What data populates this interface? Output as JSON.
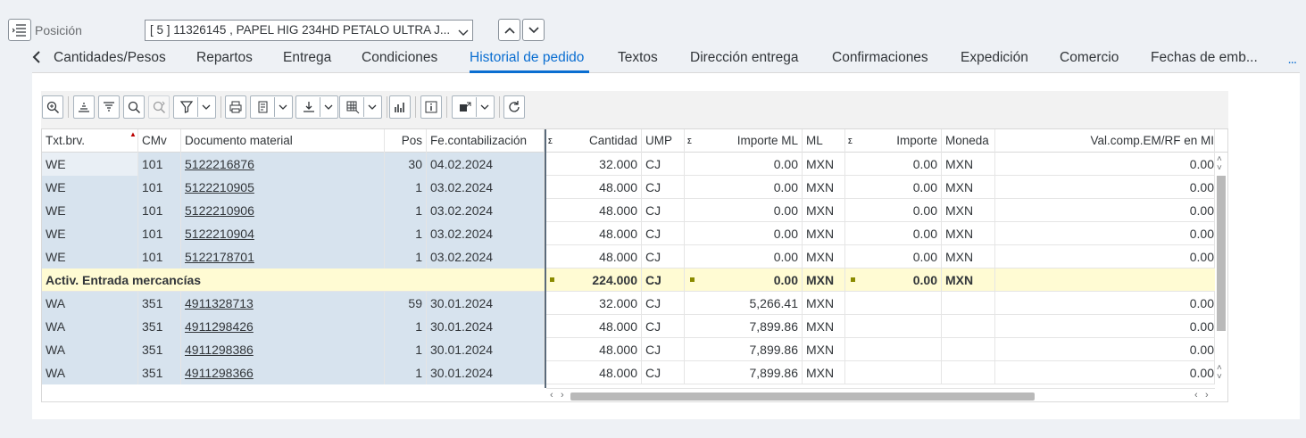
{
  "position": {
    "label": "Posición",
    "value": "[ 5 ] 11326145 , PAPEL HIG 234HD PETALO ULTRA J..."
  },
  "tabs": [
    {
      "label": "Cantidades/Pesos"
    },
    {
      "label": "Repartos"
    },
    {
      "label": "Entrega"
    },
    {
      "label": "Condiciones"
    },
    {
      "label": "Historial de pedido",
      "active": true
    },
    {
      "label": "Textos"
    },
    {
      "label": "Dirección entrega"
    },
    {
      "label": "Confirmaciones"
    },
    {
      "label": "Expedición"
    },
    {
      "label": "Comercio"
    },
    {
      "label": "Fechas de emb..."
    }
  ],
  "tabs_more": "...",
  "toolbar_icons": [
    "details-icon",
    "sort-ascending-icon",
    "sort-descending-icon",
    "find-icon",
    "find-next-icon",
    "filter-icon",
    "print-icon",
    "view-icon",
    "export-icon",
    "layout-icon",
    "chart-icon",
    "info-icon",
    "action-icon",
    "refresh-icon"
  ],
  "grid": {
    "headers": {
      "txt": "Txt.brv.",
      "cmv": "CMv",
      "doc": "Documento material",
      "pos": "Pos",
      "fecha": "Fe.contabilización",
      "cantidad": "Cantidad",
      "ump": "UMP",
      "importe_ml": "Importe ML",
      "ml": "ML",
      "importe": "Importe",
      "moneda": "Moneda",
      "valcomp": "Val.comp.EM/RF en MI"
    },
    "rows": [
      {
        "txt": "WE",
        "cmv": "101",
        "doc": "5122216876",
        "pos": "30",
        "fecha": "04.02.2024",
        "cantidad": "32.000",
        "ump": "CJ",
        "importe_ml": "0.00",
        "ml": "MXN",
        "importe": "0.00",
        "moneda": "MXN",
        "valcomp": "0.00"
      },
      {
        "txt": "WE",
        "cmv": "101",
        "doc": "5122210905",
        "pos": "1",
        "fecha": "03.02.2024",
        "cantidad": "48.000",
        "ump": "CJ",
        "importe_ml": "0.00",
        "ml": "MXN",
        "importe": "0.00",
        "moneda": "MXN",
        "valcomp": "0.00"
      },
      {
        "txt": "WE",
        "cmv": "101",
        "doc": "5122210906",
        "pos": "1",
        "fecha": "03.02.2024",
        "cantidad": "48.000",
        "ump": "CJ",
        "importe_ml": "0.00",
        "ml": "MXN",
        "importe": "0.00",
        "moneda": "MXN",
        "valcomp": "0.00"
      },
      {
        "txt": "WE",
        "cmv": "101",
        "doc": "5122210904",
        "pos": "1",
        "fecha": "03.02.2024",
        "cantidad": "48.000",
        "ump": "CJ",
        "importe_ml": "0.00",
        "ml": "MXN",
        "importe": "0.00",
        "moneda": "MXN",
        "valcomp": "0.00"
      },
      {
        "txt": "WE",
        "cmv": "101",
        "doc": "5122178701",
        "pos": "1",
        "fecha": "03.02.2024",
        "cantidad": "48.000",
        "ump": "CJ",
        "importe_ml": "0.00",
        "ml": "MXN",
        "importe": "0.00",
        "moneda": "MXN",
        "valcomp": "0.00"
      },
      {
        "subtotal": true,
        "label": "Activ. Entrada mercancías",
        "cantidad": "224.000",
        "ump": "CJ",
        "importe_ml": "0.00",
        "ml": "MXN",
        "importe": "0.00",
        "moneda": "MXN"
      },
      {
        "txt": "WA",
        "cmv": "351",
        "doc": "4911328713",
        "pos": "59",
        "fecha": "30.01.2024",
        "cantidad": "32.000",
        "ump": "CJ",
        "importe_ml": "5,266.41",
        "ml": "MXN",
        "importe": "",
        "moneda": "",
        "valcomp": "0.00"
      },
      {
        "txt": "WA",
        "cmv": "351",
        "doc": "4911298426",
        "pos": "1",
        "fecha": "30.01.2024",
        "cantidad": "48.000",
        "ump": "CJ",
        "importe_ml": "7,899.86",
        "ml": "MXN",
        "importe": "",
        "moneda": "",
        "valcomp": "0.00"
      },
      {
        "txt": "WA",
        "cmv": "351",
        "doc": "4911298386",
        "pos": "1",
        "fecha": "30.01.2024",
        "cantidad": "48.000",
        "ump": "CJ",
        "importe_ml": "7,899.86",
        "ml": "MXN",
        "importe": "",
        "moneda": "",
        "valcomp": "0.00"
      },
      {
        "txt": "WA",
        "cmv": "351",
        "doc": "4911298366",
        "pos": "1",
        "fecha": "30.01.2024",
        "cantidad": "48.000",
        "ump": "CJ",
        "importe_ml": "7,899.86",
        "ml": "MXN",
        "importe": "",
        "moneda": "",
        "valcomp": "0.00"
      }
    ]
  },
  "colors": {
    "accent": "#0a6ed1",
    "key_column": "#d7e3ee",
    "subtotal_row": "#fffbd3"
  }
}
